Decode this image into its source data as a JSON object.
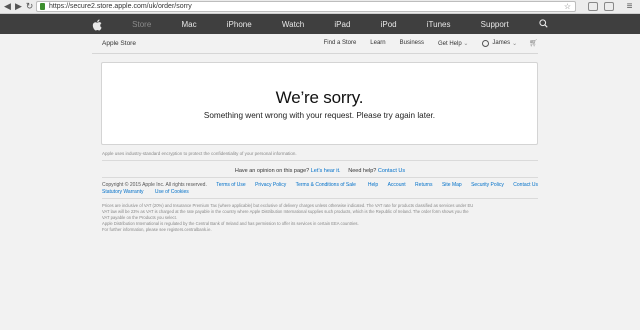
{
  "browser": {
    "url": "https://secure2.store.apple.com/uk/order/sorry"
  },
  "globalnav": {
    "items": [
      "Store",
      "Mac",
      "iPhone",
      "Watch",
      "iPad",
      "iPod",
      "iTunes",
      "Support"
    ]
  },
  "subnav": {
    "title": "Apple Store",
    "links": [
      "Find a Store",
      "Learn",
      "Business",
      "Get Help"
    ],
    "user": "James",
    "gethelp_chevron": "⌄"
  },
  "main": {
    "heading": "We’re sorry.",
    "message": "Something went wrong with your request. Please try again later."
  },
  "encryption_note": "Apple uses industry-standard encryption to protect the confidentiality of your personal information.",
  "opinion": {
    "question": "Have an opinion on this page?",
    "link": "Let’s hear it.",
    "help": "Need help?",
    "help_link": "Contact Us"
  },
  "footer": {
    "copyright": "Copyright © 2015 Apple Inc. All rights reserved.",
    "left_links": [
      "Terms of Use",
      "Privacy Policy",
      "Terms & Conditions of Sale"
    ],
    "right_links": [
      "Help",
      "Account",
      "Returns",
      "Site Map",
      "Security Policy",
      "Contact Us"
    ],
    "row2_links": [
      "Statutory Warranty",
      "Use of Cookies"
    ],
    "legal1": "Prices are inclusive of VAT (20%) and Insurance Premium Tax (where applicable) but exclusive of delivery charges unless otherwise indicated. The VAT rate for products classified as services under EU",
    "legal2": "VAT law will be 23% as VAT is charged at the rate payable in the country where Apple Distribution International supplies such products, which is the Republic of Ireland. The order form shows you the",
    "legal3": "VAT payable on the Products you select.",
    "legal4": "Apple Distribution International is regulated by the Central Bank of Ireland and has permission to offer its services in certain EEA countries.",
    "legal5": "For further information, please see registers.centralbank.ie."
  },
  "colors": {
    "nav_bg": "#3f3f3f",
    "page_bg": "#f2f2f2",
    "link": "#0070c9"
  }
}
